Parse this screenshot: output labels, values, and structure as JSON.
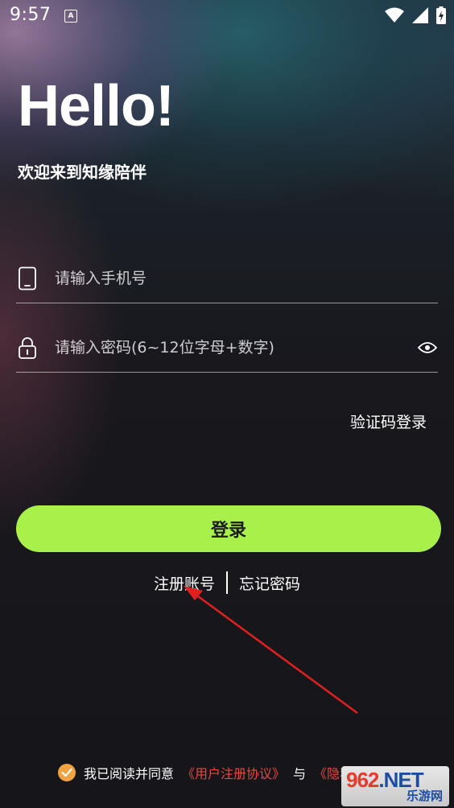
{
  "status_bar": {
    "time": "9:57",
    "notification_icon": "accessibility-a-icon",
    "wifi_icon": "wifi-icon",
    "signal_icon": "signal-icon",
    "battery_icon": "battery-charging-icon"
  },
  "greeting": {
    "title": "Hello!",
    "subtitle": "欢迎来到知缘陪伴"
  },
  "form": {
    "phone_placeholder": "请输入手机号",
    "phone_value": "",
    "password_placeholder": "请输入密码(6~12位字母+数字)",
    "password_value": "",
    "phone_icon": "phone-icon",
    "lock_icon": "lock-icon",
    "eye_icon": "eye-icon"
  },
  "sms_login_label": "验证码登录",
  "login_button_label": "登录",
  "links": {
    "register": "注册账号",
    "forgot": "忘记密码"
  },
  "agreement": {
    "prefix": "我已阅读并同意",
    "user_agreement": "《用户注册协议》",
    "conjunction": "与",
    "privacy_policy": "《隐私政策》"
  },
  "watermark": {
    "top_num": "962",
    "top_text": ".NET",
    "bottom": "乐游网"
  },
  "colors": {
    "accent": "#a8f14a",
    "checkbox": "#f0a340",
    "link_red": "#e8473e",
    "annotation_arrow": "#e02020"
  }
}
